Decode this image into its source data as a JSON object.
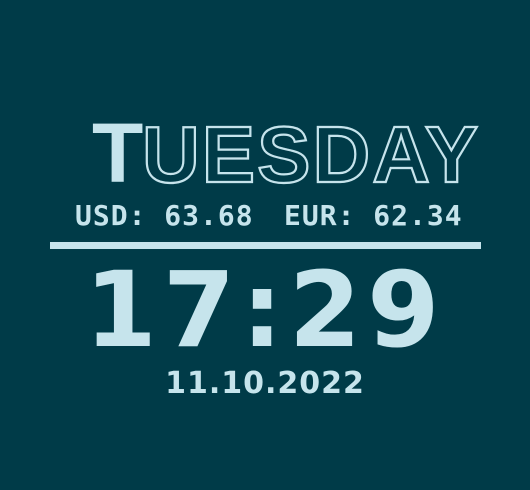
{
  "weekday": {
    "first_letter": "T",
    "rest": "UESDAY"
  },
  "rates": {
    "usd": "USD: 63.68",
    "eur": "EUR: 62.34"
  },
  "time": "17:29",
  "date": "11.10.2022",
  "colors": {
    "background": "#003b48",
    "foreground": "#c6e4ec"
  }
}
